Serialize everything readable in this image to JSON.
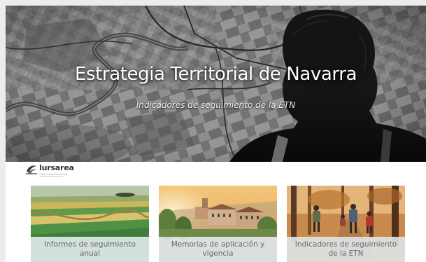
{
  "hero": {
    "title": "Estrategia Territorial de Navarra",
    "subtitle": "Indicadores de seguimiento de la ETN",
    "background_image": "aerial-map-with-person-photo"
  },
  "brand": {
    "name": "lursarea",
    "logo_icon": "lursarea-logo-icon"
  },
  "cards": [
    {
      "label": "Informes de seguimiento anual",
      "image": "green-fields-landscape-photo"
    },
    {
      "label": "Memorias de aplicación y vigencia",
      "image": "village-sunset-photo"
    },
    {
      "label": "Indicadores de seguimiento de la ETN",
      "image": "forest-hikers-photo"
    }
  ],
  "colors": {
    "caption_bg": "#e0e7eb",
    "caption_text": "#636b70",
    "hero_text": "#ffffff"
  }
}
